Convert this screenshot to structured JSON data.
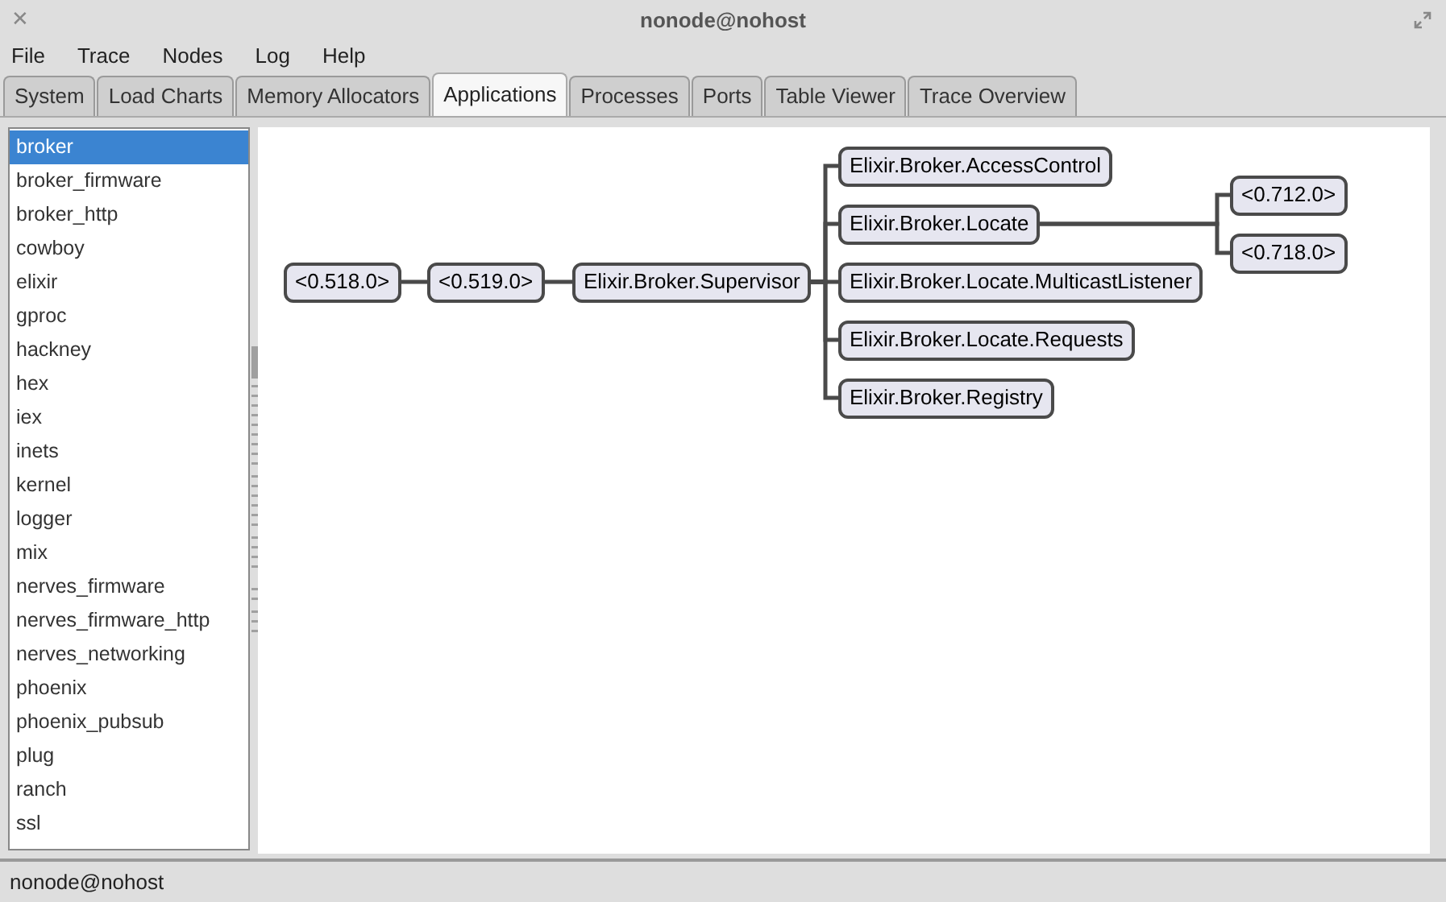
{
  "window": {
    "title": "nonode@nohost",
    "close_glyph": "✕"
  },
  "menu": [
    "File",
    "Trace",
    "Nodes",
    "Log",
    "Help"
  ],
  "tabs": [
    {
      "label": "System",
      "selected": false
    },
    {
      "label": "Load Charts",
      "selected": false
    },
    {
      "label": "Memory Allocators",
      "selected": false
    },
    {
      "label": "Applications",
      "selected": true
    },
    {
      "label": "Processes",
      "selected": false
    },
    {
      "label": "Ports",
      "selected": false
    },
    {
      "label": "Table Viewer",
      "selected": false
    },
    {
      "label": "Trace Overview",
      "selected": false
    }
  ],
  "applications": [
    {
      "label": "broker",
      "selected": true
    },
    {
      "label": "broker_firmware",
      "selected": false
    },
    {
      "label": "broker_http",
      "selected": false
    },
    {
      "label": "cowboy",
      "selected": false
    },
    {
      "label": "elixir",
      "selected": false
    },
    {
      "label": "gproc",
      "selected": false
    },
    {
      "label": "hackney",
      "selected": false
    },
    {
      "label": "hex",
      "selected": false
    },
    {
      "label": "iex",
      "selected": false
    },
    {
      "label": "inets",
      "selected": false
    },
    {
      "label": "kernel",
      "selected": false
    },
    {
      "label": "logger",
      "selected": false
    },
    {
      "label": "mix",
      "selected": false
    },
    {
      "label": "nerves_firmware",
      "selected": false
    },
    {
      "label": "nerves_firmware_http",
      "selected": false
    },
    {
      "label": "nerves_networking",
      "selected": false
    },
    {
      "label": "phoenix",
      "selected": false
    },
    {
      "label": "phoenix_pubsub",
      "selected": false
    },
    {
      "label": "plug",
      "selected": false
    },
    {
      "label": "ranch",
      "selected": false
    },
    {
      "label": "ssl",
      "selected": false
    }
  ],
  "process_tree": {
    "label": "<0.518.0>",
    "children": [
      {
        "label": "<0.519.0>",
        "children": [
          {
            "label": "Elixir.Broker.Supervisor",
            "children": [
              {
                "label": "Elixir.Broker.AccessControl"
              },
              {
                "label": "Elixir.Broker.Locate",
                "children": [
                  {
                    "label": "<0.712.0>"
                  },
                  {
                    "label": "<0.718.0>"
                  }
                ]
              },
              {
                "label": "Elixir.Broker.Locate.MulticastListener"
              },
              {
                "label": "Elixir.Broker.Locate.Requests"
              },
              {
                "label": "Elixir.Broker.Registry"
              }
            ]
          }
        ]
      }
    ]
  },
  "status_bar": "nonode@nohost"
}
